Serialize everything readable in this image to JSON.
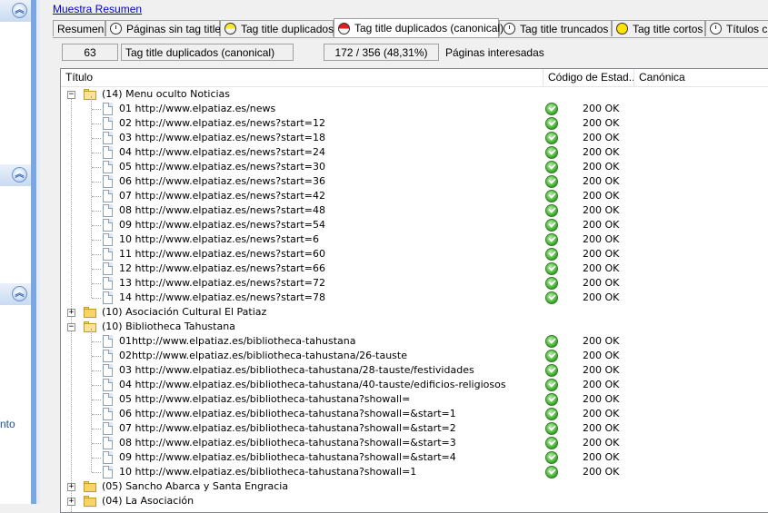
{
  "sidebar": {
    "collapse_icons": [
      "chevron-up-icon",
      "chevron-up-icon",
      "chevron-up-icon"
    ],
    "partial_text": "nto"
  },
  "summary_link": "Muestra Resumen",
  "tabs": [
    {
      "label": "Resumen",
      "icon": "none"
    },
    {
      "label": "Páginas sin tag title",
      "icon": "clock-icon"
    },
    {
      "label": "Tag title duplicados",
      "icon": "yellow-half-circle-icon"
    },
    {
      "label": "Tag title duplicados (canonical)",
      "icon": "red-half-circle-icon",
      "active": true
    },
    {
      "label": "Tag title truncados",
      "icon": "clock-icon"
    },
    {
      "label": "Tag title cortos",
      "icon": "yellow-circle-icon"
    },
    {
      "label": "Títulos c",
      "icon": "clock-icon"
    }
  ],
  "counters": {
    "count": "63",
    "category": "Tag title duplicados (canonical)",
    "ratio": "172 / 356 (48,31%)",
    "pages_label": "Páginas interesadas"
  },
  "columns": {
    "title": "Título",
    "status": "Código de Estad...",
    "canonical": "Canónica"
  },
  "tree": [
    {
      "type": "group",
      "expanded": true,
      "label": "(14) Menu oculto Noticias",
      "items": [
        {
          "label": "01 http://www.elpatiaz.es/news",
          "code": "200 OK"
        },
        {
          "label": "02 http://www.elpatiaz.es/news?start=12",
          "code": "200 OK"
        },
        {
          "label": "03 http://www.elpatiaz.es/news?start=18",
          "code": "200 OK"
        },
        {
          "label": "04 http://www.elpatiaz.es/news?start=24",
          "code": "200 OK"
        },
        {
          "label": "05 http://www.elpatiaz.es/news?start=30",
          "code": "200 OK"
        },
        {
          "label": "06 http://www.elpatiaz.es/news?start=36",
          "code": "200 OK"
        },
        {
          "label": "07 http://www.elpatiaz.es/news?start=42",
          "code": "200 OK"
        },
        {
          "label": "08 http://www.elpatiaz.es/news?start=48",
          "code": "200 OK"
        },
        {
          "label": "09 http://www.elpatiaz.es/news?start=54",
          "code": "200 OK"
        },
        {
          "label": "10 http://www.elpatiaz.es/news?start=6",
          "code": "200 OK"
        },
        {
          "label": "11 http://www.elpatiaz.es/news?start=60",
          "code": "200 OK"
        },
        {
          "label": "12 http://www.elpatiaz.es/news?start=66",
          "code": "200 OK"
        },
        {
          "label": "13 http://www.elpatiaz.es/news?start=72",
          "code": "200 OK"
        },
        {
          "label": "14 http://www.elpatiaz.es/news?start=78",
          "code": "200 OK"
        }
      ]
    },
    {
      "type": "group",
      "expanded": false,
      "label": "(10) Asociación Cultural El Patiaz",
      "items": []
    },
    {
      "type": "group",
      "expanded": true,
      "label": "(10) Bibliotheca Tahustana",
      "items": [
        {
          "label": "01http://www.elpatiaz.es/bibliotheca-tahustana",
          "code": "200 OK"
        },
        {
          "label": "02http://www.elpatiaz.es/bibliotheca-tahustana/26-tauste",
          "code": "200 OK"
        },
        {
          "label": "03 http://www.elpatiaz.es/bibliotheca-tahustana/28-tauste/festividades",
          "code": "200 OK"
        },
        {
          "label": "04 http://www.elpatiaz.es/bibliotheca-tahustana/40-tauste/edificios-religiosos",
          "code": "200 OK"
        },
        {
          "label": "05 http://www.elpatiaz.es/bibliotheca-tahustana?showall=",
          "code": "200 OK"
        },
        {
          "label": "06 http://www.elpatiaz.es/bibliotheca-tahustana?showall=&start=1",
          "code": "200 OK"
        },
        {
          "label": "07 http://www.elpatiaz.es/bibliotheca-tahustana?showall=&start=2",
          "code": "200 OK"
        },
        {
          "label": "08 http://www.elpatiaz.es/bibliotheca-tahustana?showall=&start=3",
          "code": "200 OK"
        },
        {
          "label": "09 http://www.elpatiaz.es/bibliotheca-tahustana?showall=&start=4",
          "code": "200 OK"
        },
        {
          "label": "10 http://www.elpatiaz.es/bibliotheca-tahustana?showall=1",
          "code": "200 OK"
        }
      ]
    },
    {
      "type": "group",
      "expanded": false,
      "label": "(05) Sancho Abarca y Santa Engracia",
      "items": []
    },
    {
      "type": "group",
      "expanded": false,
      "label": "(04) La Asociación",
      "items": []
    }
  ],
  "colors": {
    "sidebar_strip": "#7aa7df",
    "link": "#0000cc",
    "ok_green": "#3aa82c",
    "folder": "#f6d46a"
  }
}
